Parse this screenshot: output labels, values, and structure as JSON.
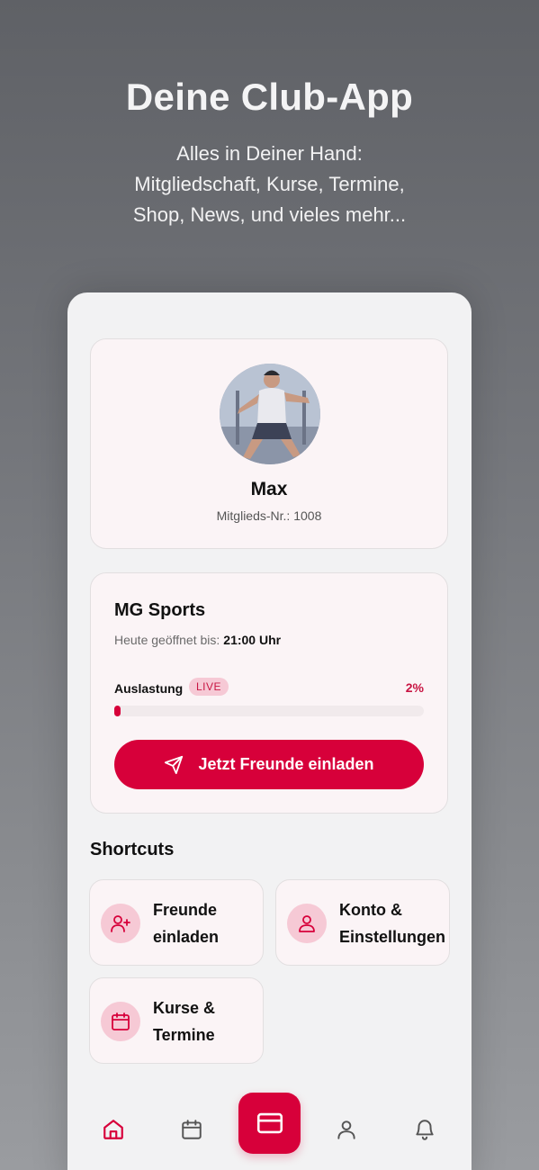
{
  "hero": {
    "title": "Deine Club-App",
    "subtitle_lines": [
      "Alles in Deiner Hand:",
      "Mitgliedschaft, Kurse, Termine,",
      "Shop, News, und vieles mehr..."
    ]
  },
  "profile": {
    "name": "Max",
    "member_id": "Mitglieds-Nr.: 1008"
  },
  "club": {
    "name": "MG Sports",
    "open_label": "Heute geöffnet bis:",
    "open_until": "21:00 Uhr",
    "load_label": "Auslastung",
    "live_badge": "LIVE",
    "load_percent_text": "2%",
    "load_fraction": 0.02,
    "invite_button": "Jetzt Freunde einladen"
  },
  "shortcuts": {
    "title": "Shortcuts",
    "items": [
      {
        "line1": "Freunde",
        "line2": "einladen",
        "icon": "user-plus-icon"
      },
      {
        "line1": "Konto &",
        "line2": "Einstellungen",
        "icon": "user-icon"
      },
      {
        "line1": "Kurse &",
        "line2": "Termine",
        "icon": "calendar-icon"
      }
    ]
  },
  "nav": {
    "items": [
      "home-icon",
      "calendar-icon",
      "card-icon",
      "user-icon",
      "bell-icon"
    ],
    "active": "home-icon"
  },
  "colors": {
    "accent": "#d7003a",
    "accent_soft": "#f6c9d5",
    "card_bg": "#fbf4f6"
  }
}
